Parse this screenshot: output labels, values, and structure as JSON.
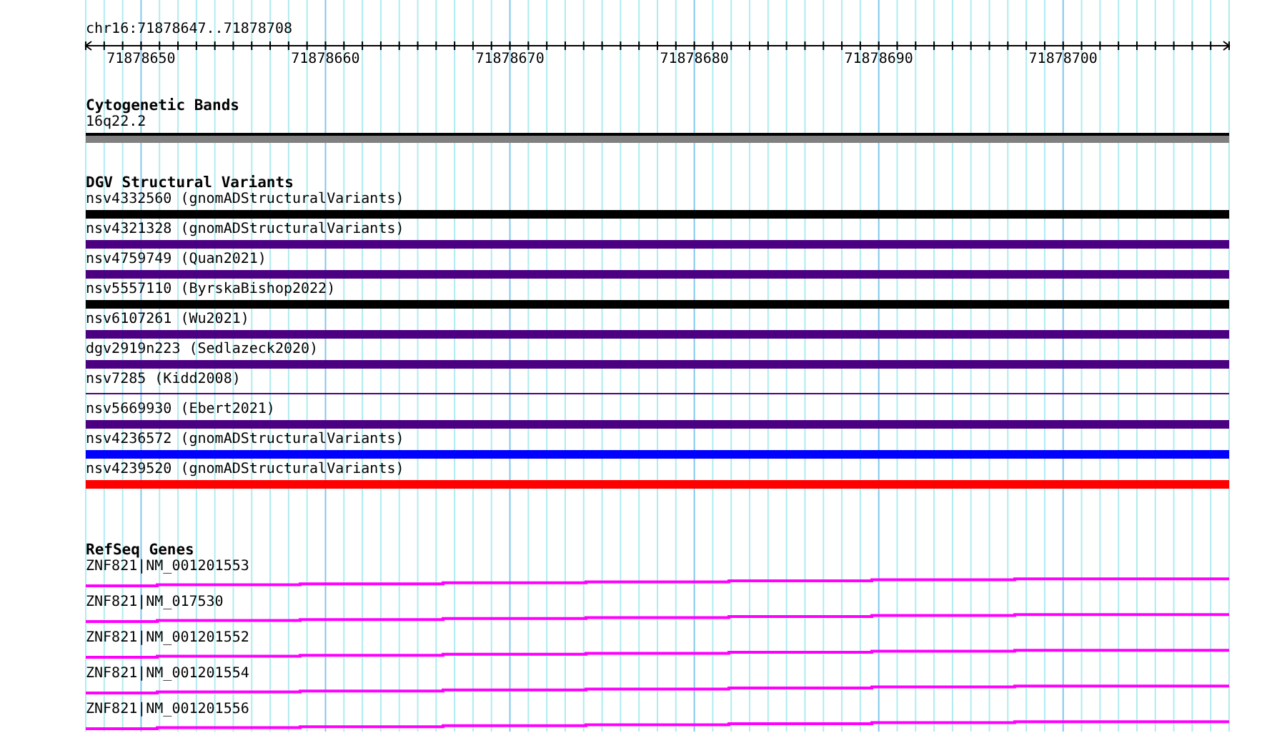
{
  "ruler": {
    "title": "chr16:71878647..71878708",
    "ticks": [
      "71878650",
      "71878660",
      "71878670",
      "71878680",
      "71878690",
      "71878700"
    ]
  },
  "cytogenetic_bands": {
    "title": "Cytogenetic Bands",
    "bands": [
      {
        "name": "16q22.2"
      }
    ]
  },
  "dgv_structural_variants": {
    "title": "DGV Structural Variants",
    "items": [
      {
        "label": "nsv4332560 (gnomADStructuralVariants)",
        "color": "#000000",
        "kind": "bar"
      },
      {
        "label": "nsv4321328 (gnomADStructuralVariants)",
        "color": "#4b0082",
        "kind": "bar"
      },
      {
        "label": "nsv4759749 (Quan2021)",
        "color": "#4b0082",
        "kind": "bar"
      },
      {
        "label": "nsv5557110 (ByrskaBishop2022)",
        "color": "#000000",
        "kind": "bar"
      },
      {
        "label": "nsv6107261 (Wu2021)",
        "color": "#4b0082",
        "kind": "bar"
      },
      {
        "label": "dgv2919n223 (Sedlazeck2020)",
        "color": "#4b0082",
        "kind": "bar"
      },
      {
        "label": "nsv7285 (Kidd2008)",
        "color": "#4b0082",
        "kind": "line"
      },
      {
        "label": "nsv5669930 (Ebert2021)",
        "color": "#4b0082",
        "kind": "bar"
      },
      {
        "label": "nsv4236572 (gnomADStructuralVariants)",
        "color": "#0000ff",
        "kind": "bar"
      },
      {
        "label": "nsv4239520 (gnomADStructuralVariants)",
        "color": "#ff0000",
        "kind": "bar"
      }
    ]
  },
  "refseq_genes": {
    "title": "RefSeq Genes",
    "genes": [
      {
        "name": "ZNF821|NM_001201553"
      },
      {
        "name": "ZNF821|NM_017530"
      },
      {
        "name": "ZNF821|NM_001201552"
      },
      {
        "name": "ZNF821|NM_001201554"
      },
      {
        "name": "ZNF821|NM_001201556"
      }
    ]
  }
}
